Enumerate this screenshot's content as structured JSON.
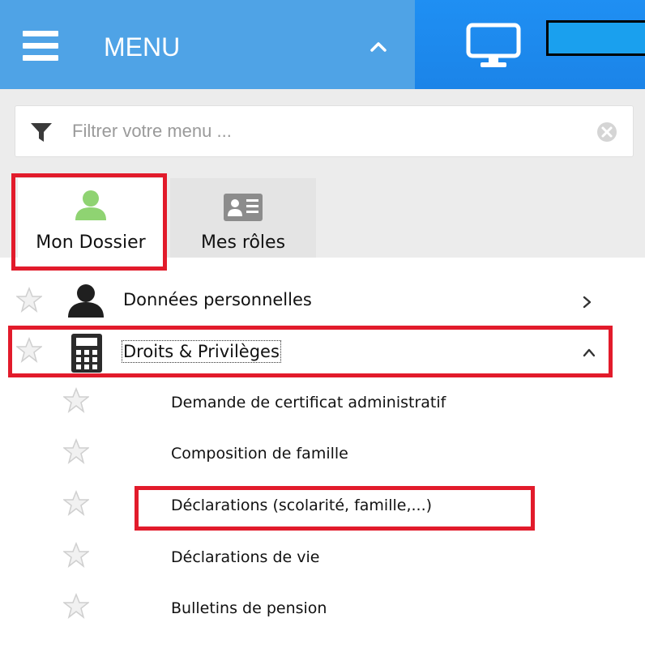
{
  "header": {
    "menu_title": "MENU",
    "icons": {
      "hamburger": "hamburger-icon",
      "collapse": "chevron-up-icon",
      "monitor": "monitor-icon"
    },
    "colors": {
      "menu_bar": "#4fa3e6",
      "right_bar": "#1f8ff3",
      "box_fill": "#1aa0ee"
    }
  },
  "filter": {
    "placeholder": "Filtrer votre menu ...",
    "value": ""
  },
  "tabs": [
    {
      "label": "Mon Dossier",
      "icon": "user-icon",
      "active": true
    },
    {
      "label": "Mes rôles",
      "icon": "id-card-icon",
      "active": false
    }
  ],
  "menu": {
    "items": [
      {
        "label": "Données personnelles",
        "icon": "person-silhouette-icon",
        "expanded": false
      },
      {
        "label": "Droits & Privilèges",
        "icon": "calculator-icon",
        "expanded": true
      }
    ],
    "subitems": [
      {
        "label": "Demande de certificat administratif"
      },
      {
        "label": "Composition de famille"
      },
      {
        "label": "Déclarations (scolarité, famille,...)"
      },
      {
        "label": "Déclarations de vie"
      },
      {
        "label": "Bulletins de pension"
      }
    ]
  },
  "annotation_color": "#e21b2b"
}
